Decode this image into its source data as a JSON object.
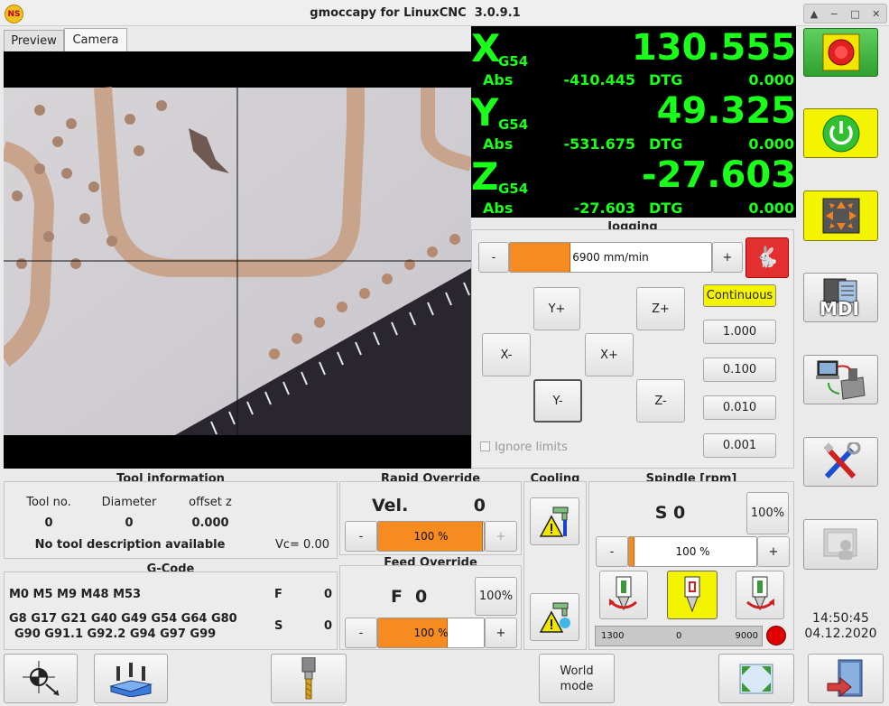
{
  "window": {
    "title": "gmoccapy for LinuxCNC  3.0.9.1"
  },
  "tabs": [
    {
      "label": "Preview"
    },
    {
      "label": "Camera"
    }
  ],
  "dro": {
    "x": {
      "axis": "X",
      "coord": "G54",
      "value": "130.555",
      "abs_label": "Abs",
      "abs": "-410.445",
      "dtg_label": "DTG",
      "dtg": "0.000"
    },
    "y": {
      "axis": "Y",
      "coord": "G54",
      "value": "49.325",
      "abs_label": "Abs",
      "abs": "-531.675",
      "dtg_label": "DTG",
      "dtg": "0.000"
    },
    "z": {
      "axis": "Z",
      "coord": "G54",
      "value": "-27.603",
      "abs_label": "Abs",
      "abs": "-27.603",
      "dtg_label": "DTG",
      "dtg": "0.000"
    }
  },
  "jogging": {
    "title": "Jogging",
    "minus": "-",
    "plus": "+",
    "speed": "6900",
    "unit": "mm/min",
    "speed_fraction": 0.3,
    "buttons": {
      "yplus": "Y+",
      "zplus": "Z+",
      "xminus": "X-",
      "xplus": "X+",
      "yminus": "Y-",
      "zminus": "Z-"
    },
    "increments": [
      "Continuous",
      "1.000",
      "0.100",
      "0.010",
      "0.001"
    ],
    "ignore_limits": "Ignore limits"
  },
  "tool": {
    "title": "Tool information",
    "h_no": "Tool no.",
    "h_dia": "Diameter",
    "h_off": "offset z",
    "no": "0",
    "dia": "0",
    "off": "0.000",
    "desc": "No tool description available",
    "vc": "Vc= 0.00"
  },
  "gcode": {
    "title": "G-Code",
    "mcodes": "M0 M5 M9 M48 M53",
    "gcodes1": "G8 G17 G21 G40 G49 G54 G64 G80",
    "gcodes2": "G90 G91.1 G92.2 G94 G97 G99",
    "f_label": "F",
    "f_val": "0",
    "s_label": "S",
    "s_val": "0"
  },
  "rapid": {
    "title": "Rapid Override",
    "vel_label": "Vel.",
    "vel": "0",
    "minus": "-",
    "plus": "+",
    "pct": "100 %",
    "fraction": 0.99
  },
  "feed": {
    "title": "Feed Override",
    "f_label": "F",
    "f_val": "0",
    "reset": "100%",
    "minus": "-",
    "plus": "+",
    "pct": "100 %",
    "fraction": 0.66
  },
  "cooling": {
    "title": "Cooling"
  },
  "spindle": {
    "title": "Spindle [rpm]",
    "s": "S 0",
    "reset": "100%",
    "minus": "-",
    "plus": "+",
    "pct": "100 %",
    "fraction": 0.04,
    "gauge_min": "1300",
    "gauge_mid": "0",
    "gauge_max": "9000"
  },
  "bottom": {
    "world_mode": "World\nmode"
  },
  "side": {
    "mdi": "MDI"
  },
  "clock": {
    "time": "14:50:45",
    "date": "04.12.2020"
  },
  "colors": {
    "accent": "#f68b1f",
    "dro_green": "#1aff1a",
    "highlight": "#f4f400"
  }
}
